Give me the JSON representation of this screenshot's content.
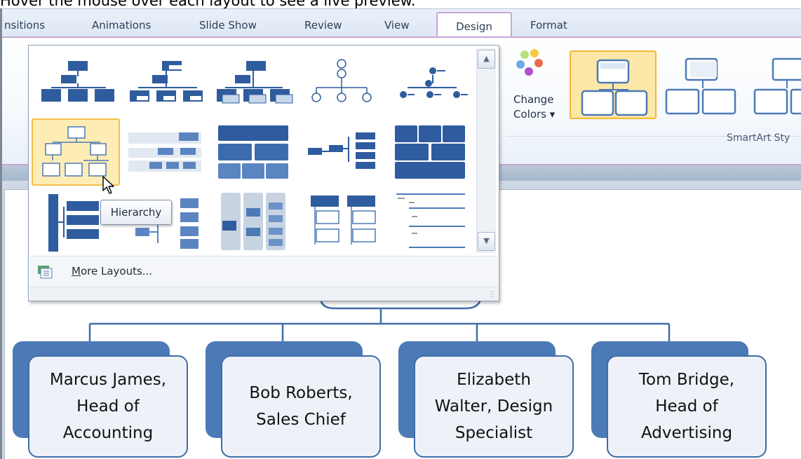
{
  "caption": "Hover the mouse over each layout to see a live preview.",
  "tabs": {
    "transitions": "nsitions",
    "animations": "Animations",
    "slide_show": "Slide Show",
    "review": "Review",
    "view": "View",
    "design": "Design",
    "format": "Format"
  },
  "ribbon": {
    "change_colors_line1": "Change",
    "change_colors_line2": "Colors ▾",
    "smartart_styles": "SmartArt Sty"
  },
  "gallery": {
    "more_layouts": "More Layouts...",
    "more_layouts_underline": "M",
    "more_layouts_rest": "ore Layouts...",
    "tooltip": "Hierarchy",
    "selected_layout": "Hierarchy",
    "scroll_up": "▲",
    "scroll_down": "▼"
  },
  "org_chart": {
    "nodes": [
      {
        "text": "Marcus James,\nHead of\nAccounting"
      },
      {
        "text": "Bob Roberts,\nSales Chief"
      },
      {
        "text": "Elizabeth\nWalter, Design\nSpecialist"
      },
      {
        "text": "Tom Bridge,\nHead of\nAdvertising"
      }
    ]
  },
  "colors": {
    "accent_purple": "#c8a6d6",
    "node_blue": "#4c7ab6",
    "selection_yellow": "#f3c04a"
  }
}
